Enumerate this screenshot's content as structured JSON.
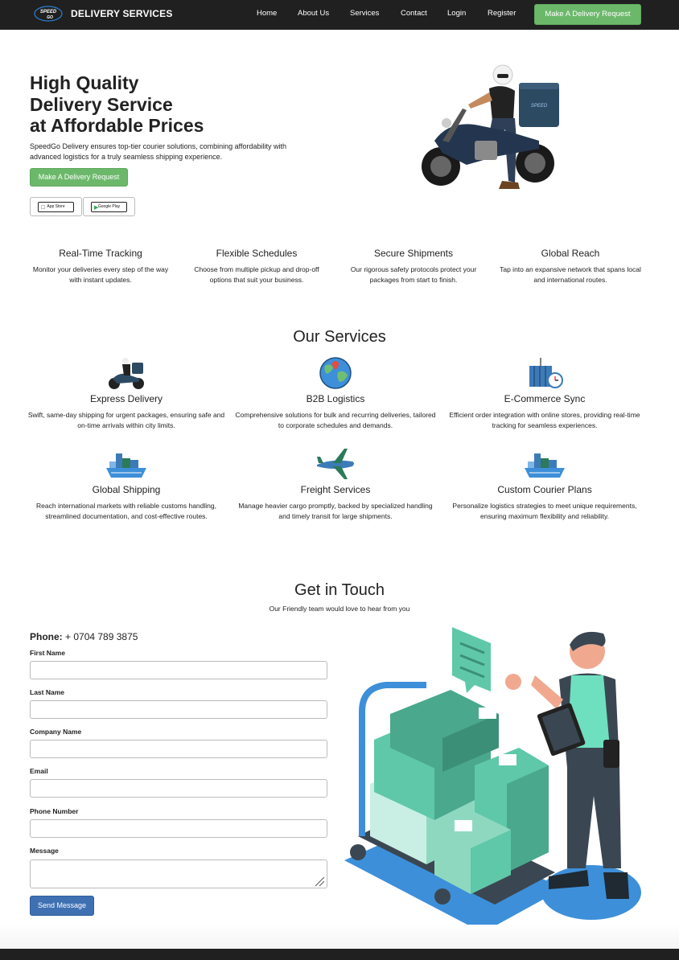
{
  "navbar": {
    "brand_logo_text": "SPEED GO",
    "brand": "DELIVERY SERVICES",
    "links": [
      "Home",
      "About Us",
      "Services",
      "Contact",
      "Login",
      "Register"
    ],
    "cta": "Make A Delivery Request"
  },
  "hero": {
    "title_lines": [
      "High Quality",
      "Delivery Service",
      "at Affordable Prices"
    ],
    "description": "SpeedGo Delivery ensures top-tier courier solutions, combining affordability with advanced logistics for a truly seamless shipping experience.",
    "cta": "Make A Delivery Request",
    "app_store": "App Store",
    "google_play": "Google Play",
    "image_icon": "delivery-rider-motorcycle-icon"
  },
  "features": [
    {
      "title": "Real-Time Tracking",
      "text": "Monitor your deliveries every step of the way with instant updates."
    },
    {
      "title": "Flexible Schedules",
      "text": "Choose from multiple pickup and drop-off options that suit your business."
    },
    {
      "title": "Secure Shipments",
      "text": "Our rigorous safety protocols protect your packages from start to finish."
    },
    {
      "title": "Global Reach",
      "text": "Tap into an expansive network that spans local and international routes."
    }
  ],
  "services": {
    "title": "Our Services",
    "items": [
      {
        "title": "Express Delivery",
        "text": "Swift, same-day shipping for urgent packages, ensuring safe and on-time arrivals within city limits.",
        "icon": "motorcycle-courier-icon"
      },
      {
        "title": "B2B Logistics",
        "text": "Comprehensive solutions for bulk and recurring deliveries, tailored to corporate schedules and demands.",
        "icon": "globe-location-icon"
      },
      {
        "title": "E-Commerce Sync",
        "text": "Efficient order integration with online stores, providing real-time tracking for seamless experiences.",
        "icon": "container-clock-icon"
      },
      {
        "title": "Global Shipping",
        "text": "Reach international markets with reliable customs handling, streamlined documentation, and cost-effective routes.",
        "icon": "cargo-ship-icon"
      },
      {
        "title": "Freight Services",
        "text": "Manage heavier cargo promptly, backed by specialized handling and timely transit for large shipments.",
        "icon": "airplane-icon"
      },
      {
        "title": "Custom Courier Plans",
        "text": "Personalize logistics strategies to meet unique requirements, ensuring maximum flexibility and reliability.",
        "icon": "cargo-ship-icon"
      }
    ]
  },
  "contact": {
    "title": "Get in Touch",
    "subtitle": "Our Friendly team would love to hear from you",
    "phone_label": "Phone:",
    "phone_value": "+ 0704 789 3875",
    "fields": {
      "first_name": {
        "label": "First Name",
        "value": ""
      },
      "last_name": {
        "label": "Last Name",
        "value": ""
      },
      "company_name": {
        "label": "Company Name",
        "value": ""
      },
      "email": {
        "label": "Email",
        "value": ""
      },
      "phone_number": {
        "label": "Phone Number",
        "value": ""
      },
      "message": {
        "label": "Message",
        "value": ""
      }
    },
    "submit": "Send Message",
    "illustration_icon": "delivery-worker-boxes-cart-icon"
  },
  "colors": {
    "nav_bg": "#202020",
    "accent_green": "#6cb86b",
    "button_blue": "#3e70b2",
    "teal": "#5fc8a8"
  }
}
